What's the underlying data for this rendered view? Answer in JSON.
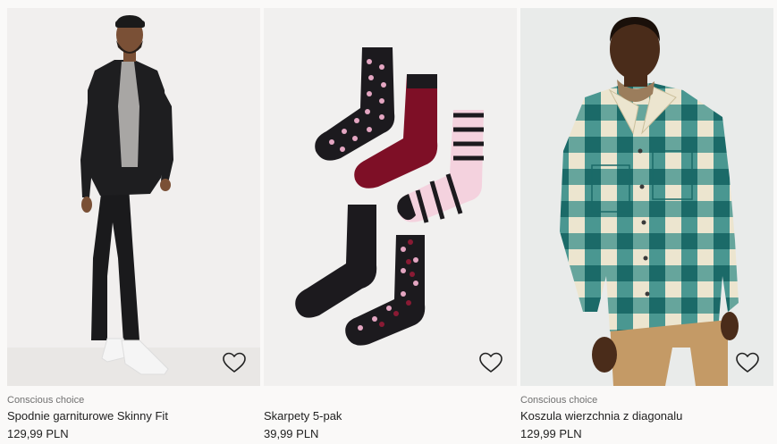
{
  "products": [
    {
      "tag": "Conscious choice",
      "title": "Spodnie garniturowe Skinny Fit",
      "price": "129,99 PLN",
      "image": "man-in-black-suit-photo",
      "favorite_icon": "heart-outline-icon"
    },
    {
      "tag": "",
      "title": "Skarpety 5-pak",
      "price": "39,99 PLN",
      "image": "socks-5-pack-photo",
      "favorite_icon": "heart-outline-icon"
    },
    {
      "tag": "Conscious choice",
      "title": "Koszula wierzchnia z diagonalu",
      "price": "129,99 PLN",
      "image": "man-in-plaid-overshirt-photo",
      "favorite_icon": "heart-outline-icon"
    }
  ],
  "colors": {
    "background": "#faf9f8",
    "image_background": "#efedec",
    "text": "#222222",
    "tag_text": "#707070"
  }
}
